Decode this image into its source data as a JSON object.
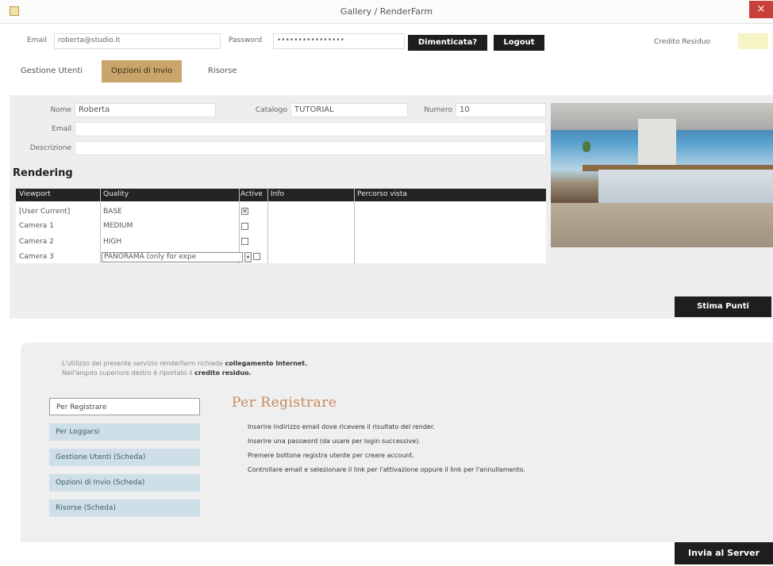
{
  "window": {
    "title": "Gallery / RenderFarm",
    "close_glyph": "×"
  },
  "login": {
    "email_label": "Email",
    "email_value": "roberta@studio.it",
    "password_label": "Password",
    "password_value": "••••••••••••••••",
    "forgot_label": "Dimenticata?",
    "logout_label": "Logout",
    "credit_label": "Credito Residuo"
  },
  "tabs": [
    {
      "label": "Gestione Utenti"
    },
    {
      "label": "Opzioni di Invio"
    },
    {
      "label": "Risorse"
    }
  ],
  "form": {
    "name_label": "Nome",
    "name_value": "Roberta",
    "catalog_label": "Catalogo",
    "catalog_value": "TUTORIAL",
    "number_label": "Numero",
    "number_value": "10",
    "email_label": "Email",
    "desc_label": "Descrizione"
  },
  "rendering": {
    "title": "Rendering",
    "columns": [
      "Viewport",
      "Quality",
      "Active",
      "Info",
      "Percorso vista"
    ],
    "rows": [
      {
        "viewport": "[User Current]",
        "quality": "BASE",
        "active": true
      },
      {
        "viewport": "Camera 1",
        "quality": "MEDIUM",
        "active": false
      },
      {
        "viewport": "Camera 2",
        "quality": "HIGH",
        "active": false
      },
      {
        "viewport": "Camera 3",
        "quality": "PANORAMA (only for expe",
        "active": false
      }
    ],
    "checked_glyph": "✕",
    "dropdown_glyph": "▾"
  },
  "right": {
    "preview_alt": "render-preview",
    "stop_label": "Stima Punti"
  },
  "info": {
    "line1_plain": "L'utilizzo del presente servizio renderfarm richiede",
    "line1_bold": "collegamento Internet.",
    "line2_plain": "Nell'angolo superiore destro è riportato il",
    "line2_bold": "credito residuo."
  },
  "menu": [
    {
      "label": "Per Registrare",
      "selected": true
    },
    {
      "label": "Per Loggarsi",
      "selected": false
    },
    {
      "label": "Gestione Utenti (Scheda)",
      "selected": false
    },
    {
      "label": "Opzioni di Invio (Scheda)",
      "selected": false
    },
    {
      "label": "Risorse (Scheda)",
      "selected": false
    }
  ],
  "section": {
    "title": "Per Registrare",
    "steps": [
      "Inserire indirizzo email dove ricevere il risultato del render.",
      "Inserire una password (da usare per login successive).",
      "Premere bottone registra utente per creare account.",
      "Controllare email e selezionare il link per l'attivazione oppure il link per l'annullamento."
    ]
  },
  "submit_label": "Invia al Server"
}
